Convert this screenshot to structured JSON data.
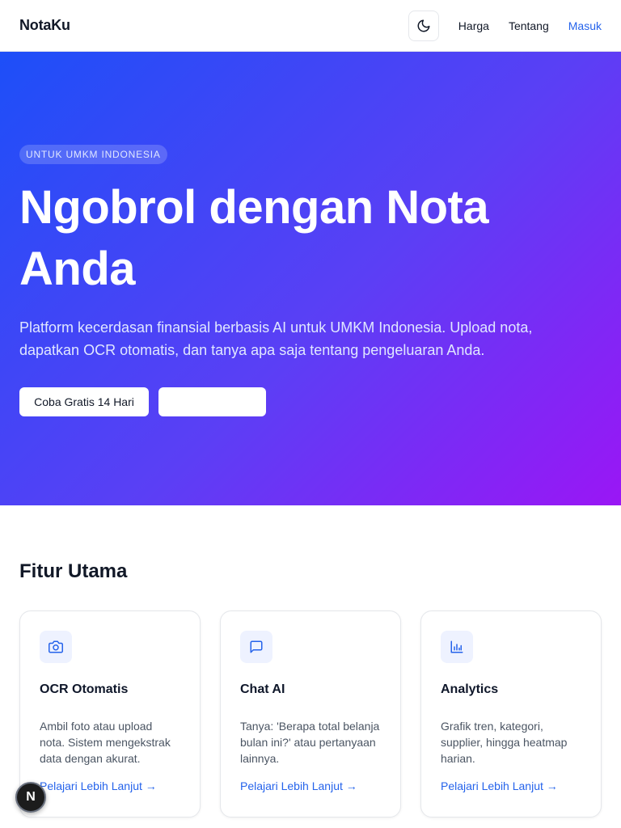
{
  "header": {
    "brand": "NotaKu",
    "theme_toggle_icon": "moon-icon",
    "nav": [
      {
        "label": "Harga"
      },
      {
        "label": "Tentang"
      },
      {
        "label": "Masuk"
      }
    ]
  },
  "hero": {
    "badge": "UNTUK UMKM INDONESIA",
    "title": "Ngobrol dengan Nota Anda",
    "description": "Platform kecerdasan finansial berbasis AI untuk UMKM Indonesia. Upload nota, dapatkan OCR otomatis, dan tanya apa saja tentang pengeluaran Anda.",
    "primary_cta": "Coba Gratis 14 Hari",
    "secondary_cta": ""
  },
  "features": {
    "title": "Fitur Utama",
    "cards": [
      {
        "icon": "camera-icon",
        "title": "OCR Otomatis",
        "description": "Ambil foto atau upload nota. Sistem mengekstrak data dengan akurat.",
        "link": "Pelajari Lebih Lanjut →"
      },
      {
        "icon": "chat-icon",
        "title": "Chat AI",
        "description": "Tanya: 'Berapa total belanja bulan ini?' atau pertanyaan lainnya.",
        "link": "Pelajari Lebih Lanjut →"
      },
      {
        "icon": "bar-chart-icon",
        "title": "Analytics",
        "description": "Grafik tren, kategori, supplier, hingga heatmap harian.",
        "link": "Pelajari Lebih Lanjut →"
      }
    ]
  },
  "dev_badge": {
    "label": "N"
  },
  "colors": {
    "accent": "#2563eb",
    "hero_gradient_start": "#1d4ff8",
    "hero_gradient_end": "#9a16f5"
  }
}
